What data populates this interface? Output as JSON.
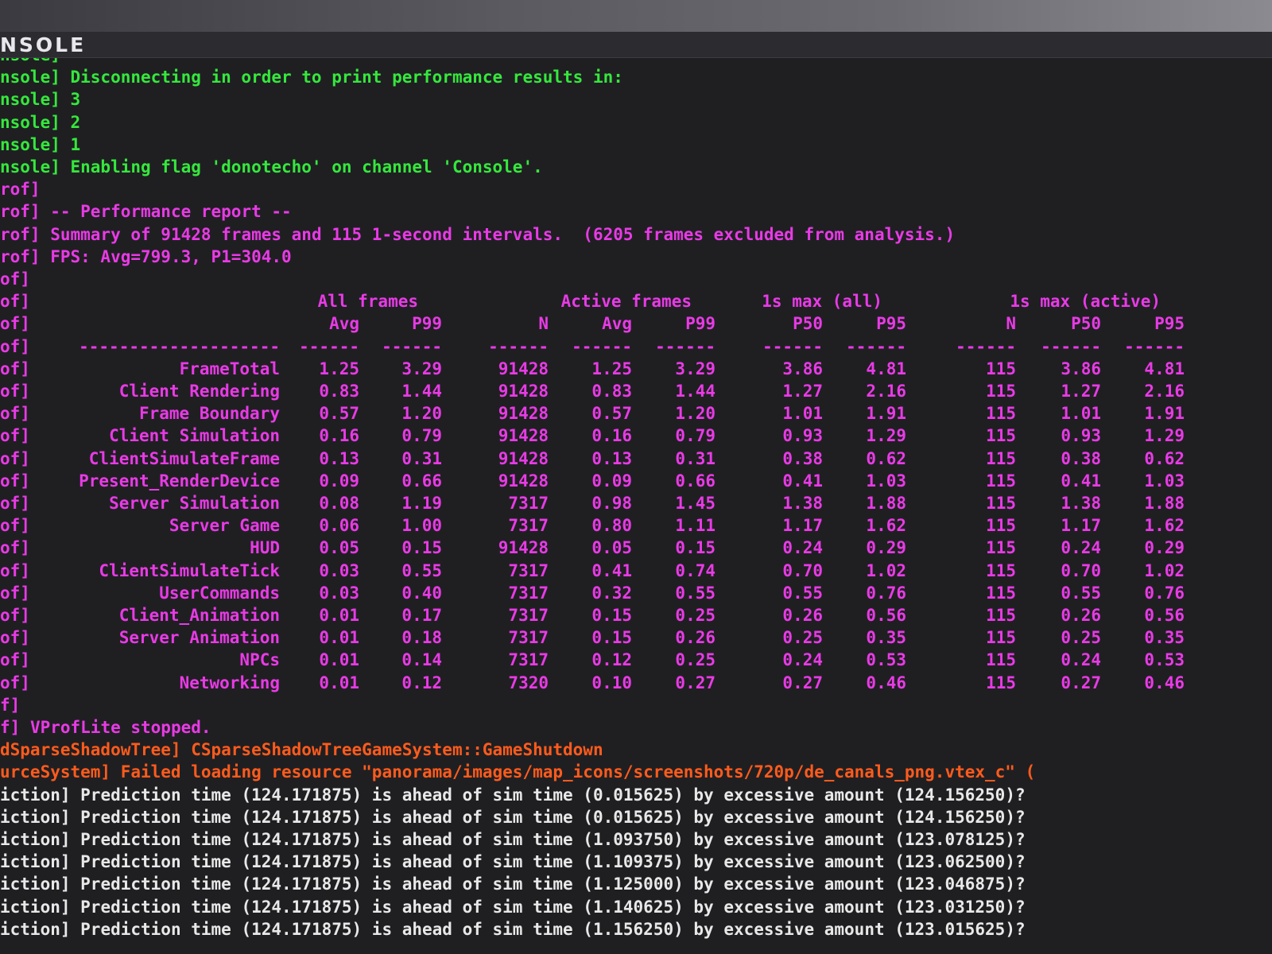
{
  "window": {
    "title": "NSOLE"
  },
  "colors": {
    "green": "#35e83c",
    "magenta": "#e93ae6",
    "orange": "#ff5b1c",
    "white": "#e8e8e8"
  },
  "console_top": [
    {
      "prefix": "nsole]",
      "text": "",
      "color": "green"
    },
    {
      "prefix": "nsole]",
      "text": " Disconnecting in order to print performance results in:",
      "color": "green"
    },
    {
      "prefix": "nsole]",
      "text": " 3",
      "color": "green"
    },
    {
      "prefix": "nsole]",
      "text": " 2",
      "color": "green"
    },
    {
      "prefix": "nsole]",
      "text": " 1",
      "color": "green"
    },
    {
      "prefix": "nsole]",
      "text": " Enabling flag 'donotecho' on channel 'Console'.",
      "color": "green"
    },
    {
      "prefix": "rof]",
      "text": "",
      "color": "magenta"
    },
    {
      "prefix": "rof]",
      "text": " -- Performance report --",
      "color": "magenta"
    },
    {
      "prefix": "rof]",
      "text": " Summary of 91428 frames and 115 1-second intervals.  (6205 frames excluded from analysis.)",
      "color": "magenta"
    },
    {
      "prefix": "rof]",
      "text": " FPS: Avg=799.3, P1=304.0",
      "color": "magenta"
    },
    {
      "prefix": "of]",
      "text": "",
      "color": "magenta"
    }
  ],
  "perf_table": {
    "group_headers": [
      "All frames",
      "Active frames",
      "1s max (all)",
      "1s max (active)"
    ],
    "sub_headers": [
      "Avg",
      "P99",
      "N",
      "Avg",
      "P99",
      "P50",
      "P95",
      "N",
      "P50",
      "P95"
    ],
    "divider": "--------------------",
    "col_divider": "------",
    "rows": [
      {
        "name": "FrameTotal",
        "values": [
          "1.25",
          "3.29",
          "91428",
          "1.25",
          "3.29",
          "3.86",
          "4.81",
          "115",
          "3.86",
          "4.81"
        ]
      },
      {
        "name": "Client Rendering",
        "values": [
          "0.83",
          "1.44",
          "91428",
          "0.83",
          "1.44",
          "1.27",
          "2.16",
          "115",
          "1.27",
          "2.16"
        ]
      },
      {
        "name": "Frame Boundary",
        "values": [
          "0.57",
          "1.20",
          "91428",
          "0.57",
          "1.20",
          "1.01",
          "1.91",
          "115",
          "1.01",
          "1.91"
        ]
      },
      {
        "name": "Client Simulation",
        "values": [
          "0.16",
          "0.79",
          "91428",
          "0.16",
          "0.79",
          "0.93",
          "1.29",
          "115",
          "0.93",
          "1.29"
        ]
      },
      {
        "name": "ClientSimulateFrame",
        "values": [
          "0.13",
          "0.31",
          "91428",
          "0.13",
          "0.31",
          "0.38",
          "0.62",
          "115",
          "0.38",
          "0.62"
        ]
      },
      {
        "name": "Present_RenderDevice",
        "values": [
          "0.09",
          "0.66",
          "91428",
          "0.09",
          "0.66",
          "0.41",
          "1.03",
          "115",
          "0.41",
          "1.03"
        ]
      },
      {
        "name": "Server Simulation",
        "values": [
          "0.08",
          "1.19",
          "7317",
          "0.98",
          "1.45",
          "1.38",
          "1.88",
          "115",
          "1.38",
          "1.88"
        ]
      },
      {
        "name": "Server Game",
        "values": [
          "0.06",
          "1.00",
          "7317",
          "0.80",
          "1.11",
          "1.17",
          "1.62",
          "115",
          "1.17",
          "1.62"
        ]
      },
      {
        "name": "HUD",
        "values": [
          "0.05",
          "0.15",
          "91428",
          "0.05",
          "0.15",
          "0.24",
          "0.29",
          "115",
          "0.24",
          "0.29"
        ]
      },
      {
        "name": "ClientSimulateTick",
        "values": [
          "0.03",
          "0.55",
          "7317",
          "0.41",
          "0.74",
          "0.70",
          "1.02",
          "115",
          "0.70",
          "1.02"
        ]
      },
      {
        "name": "UserCommands",
        "values": [
          "0.03",
          "0.40",
          "7317",
          "0.32",
          "0.55",
          "0.55",
          "0.76",
          "115",
          "0.55",
          "0.76"
        ]
      },
      {
        "name": "Client_Animation",
        "values": [
          "0.01",
          "0.17",
          "7317",
          "0.15",
          "0.25",
          "0.26",
          "0.56",
          "115",
          "0.26",
          "0.56"
        ]
      },
      {
        "name": "Server Animation",
        "values": [
          "0.01",
          "0.18",
          "7317",
          "0.15",
          "0.26",
          "0.25",
          "0.35",
          "115",
          "0.25",
          "0.35"
        ]
      },
      {
        "name": "NPCs",
        "values": [
          "0.01",
          "0.14",
          "7317",
          "0.12",
          "0.25",
          "0.24",
          "0.53",
          "115",
          "0.24",
          "0.53"
        ]
      },
      {
        "name": "Networking",
        "values": [
          "0.01",
          "0.12",
          "7320",
          "0.10",
          "0.27",
          "0.27",
          "0.46",
          "115",
          "0.27",
          "0.46"
        ]
      }
    ],
    "row_prefix": "of]"
  },
  "console_bottom": [
    {
      "prefix": "f]",
      "text": "",
      "color": "magenta"
    },
    {
      "prefix": "f]",
      "text": " VProfLite stopped.",
      "color": "magenta"
    },
    {
      "prefix": "dSparseShadowTree]",
      "text": " CSparseShadowTreeGameSystem::GameShutdown",
      "color": "orange"
    },
    {
      "prefix": "urceSystem]",
      "text": " Failed loading resource \"panorama/images/map_icons/screenshots/720p/de_canals_png.vtex_c\" (",
      "color": "orange"
    },
    {
      "prefix": "iction]",
      "text": " Prediction time (124.171875) is ahead of sim time (0.015625) by excessive amount (124.156250)?",
      "color": "white"
    },
    {
      "prefix": "iction]",
      "text": " Prediction time (124.171875) is ahead of sim time (0.015625) by excessive amount (124.156250)?",
      "color": "white"
    },
    {
      "prefix": "iction]",
      "text": " Prediction time (124.171875) is ahead of sim time (1.093750) by excessive amount (123.078125)?",
      "color": "white"
    },
    {
      "prefix": "iction]",
      "text": " Prediction time (124.171875) is ahead of sim time (1.109375) by excessive amount (123.062500)?",
      "color": "white"
    },
    {
      "prefix": "iction]",
      "text": " Prediction time (124.171875) is ahead of sim time (1.125000) by excessive amount (123.046875)?",
      "color": "white"
    },
    {
      "prefix": "iction]",
      "text": " Prediction time (124.171875) is ahead of sim time (1.140625) by excessive amount (123.031250)?",
      "color": "white"
    },
    {
      "prefix": "iction]",
      "text": " Prediction time (124.171875) is ahead of sim time (1.156250) by excessive amount (123.015625)?",
      "color": "white"
    }
  ]
}
